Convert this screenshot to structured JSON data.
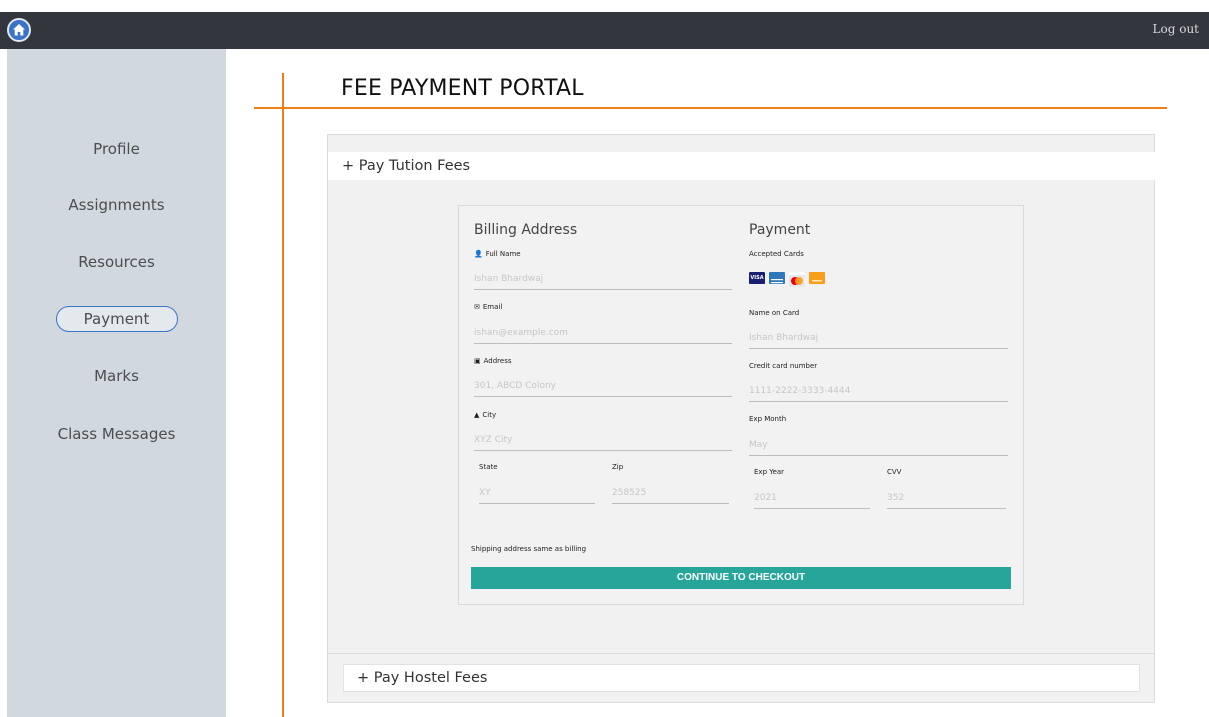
{
  "topbar": {
    "logout_label": "Log out"
  },
  "sidebar": {
    "items": [
      {
        "label": "Profile"
      },
      {
        "label": "Assignments"
      },
      {
        "label": "Resources"
      },
      {
        "label": "Payment"
      },
      {
        "label": "Marks"
      },
      {
        "label": "Class Messages"
      }
    ]
  },
  "page": {
    "title": "FEE PAYMENT PORTAL"
  },
  "accordion": {
    "tuition_header": "+  Pay Tution Fees",
    "hostel_header": "+  Pay Hostel Fees"
  },
  "billing": {
    "title": "Billing Address",
    "full_name_label": "Full Name",
    "full_name_placeholder": "Ishan Bhardwaj",
    "email_label": "Email",
    "email_placeholder": "ishan@example.com",
    "address_label": "Address",
    "address_placeholder": "301, ABCD Colony",
    "city_label": "City",
    "city_placeholder": "XYZ City",
    "state_label": "State",
    "state_placeholder": "XY",
    "zip_label": "Zip",
    "zip_placeholder": "258525"
  },
  "payment": {
    "title": "Payment",
    "accepted_cards_label": "Accepted Cards",
    "cards": [
      {
        "name": "visa",
        "color": "#1a1f71",
        "text": "VISA"
      },
      {
        "name": "amex",
        "color": "#2e77bb"
      },
      {
        "name": "mastercard",
        "color": "#eb001b"
      },
      {
        "name": "discover",
        "color": "#f79e1b"
      }
    ],
    "name_on_card_label": "Name on Card",
    "name_on_card_placeholder": "Ishan Bhardwaj",
    "card_number_label": "Credit card number",
    "card_number_placeholder": "1111-2222-3333-4444",
    "exp_month_label": "Exp Month",
    "exp_month_placeholder": "May",
    "exp_year_label": "Exp Year",
    "exp_year_placeholder": "2021",
    "cvv_label": "CVV",
    "cvv_placeholder": "352"
  },
  "shipping_label": "Shipping address same as billing",
  "checkout_label": "CONTINUE TO CHECKOUT",
  "colors": {
    "accent_orange": "#f07f15",
    "checkout_teal": "#26a69a",
    "active_blue": "#3a74c7",
    "topbar": "#33373d",
    "sidebar": "#d1d9de"
  }
}
